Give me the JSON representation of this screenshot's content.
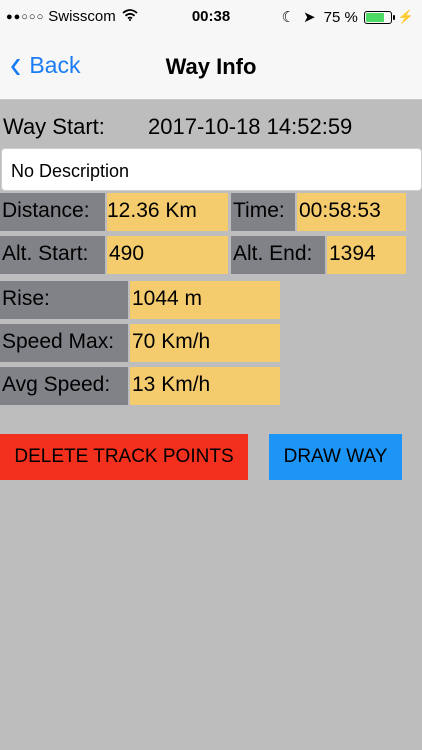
{
  "status_bar": {
    "signal": "●●○○○",
    "carrier": "Swisscom",
    "wifi_icon": "wifi-icon",
    "time": "00:38",
    "moon_icon": "☾",
    "location_icon": "➤",
    "battery_percent": "75 %",
    "battery_level": 0.75,
    "battery_color": "#4cd964",
    "charging_icon": "⚡"
  },
  "nav": {
    "back_label": "Back",
    "title": "Way Info",
    "accent": "#1a7cf5"
  },
  "way_start": {
    "label": "Way Start:",
    "value": "2017-10-18 14:52:59"
  },
  "description": {
    "value": "No Description"
  },
  "stats": {
    "distance_label": "Distance:",
    "distance_value": "12.36 Km",
    "time_label": "Time:",
    "time_value": "00:58:53",
    "alt_start_label": "Alt. Start:",
    "alt_start_value": "490",
    "alt_end_label": "Alt. End:",
    "alt_end_value": "1394",
    "rise_label": "Rise:",
    "rise_value": "1044 m",
    "speed_max_label": "Speed Max:",
    "speed_max_value": "70 Km/h",
    "avg_speed_label": "Avg Speed:",
    "avg_speed_value": "13 Km/h"
  },
  "buttons": {
    "delete_label": "DELETE TRACK POINTS",
    "draw_label": "DRAW WAY"
  },
  "colors": {
    "background": "#bdbdbd",
    "label_cell": "#818287",
    "value_cell": "#f4cc6e",
    "delete_button": "#f3301d",
    "draw_button": "#1d95f6"
  }
}
